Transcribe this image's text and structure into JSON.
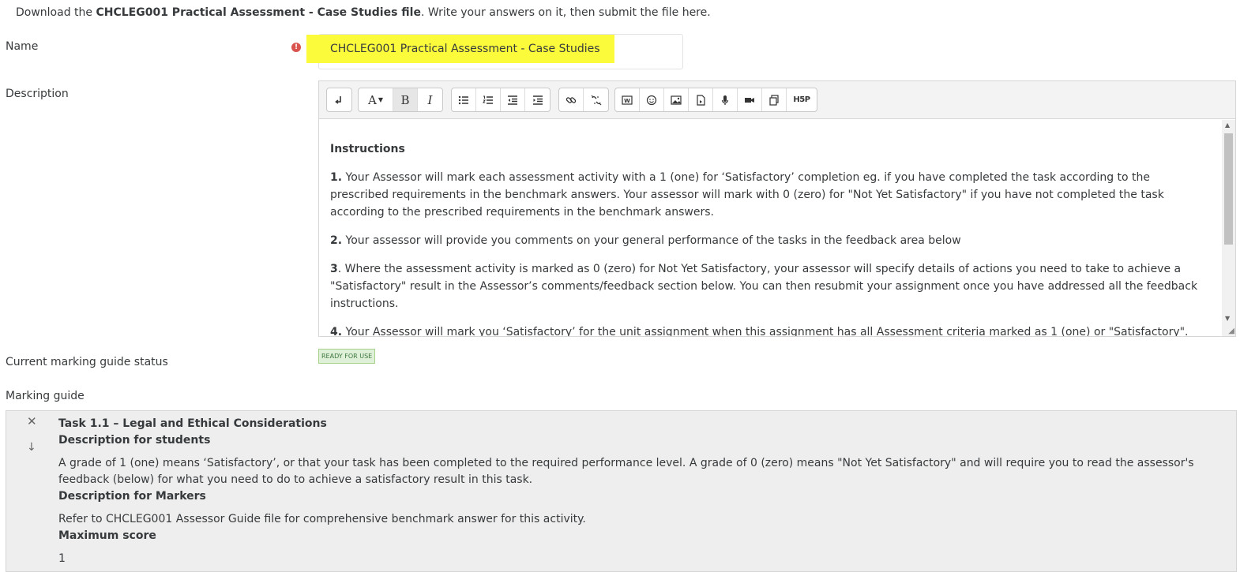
{
  "intro": {
    "prefix": "Download the ",
    "file_name": "CHCLEG001 Practical Assessment - Case Studies file",
    "suffix": ". Write your answers on it, then submit the file here."
  },
  "name_field": {
    "label": "Name",
    "value": "CHCLEG001 Practical Assessment - Case Studies",
    "required_icon": "exclamation-circle-icon"
  },
  "description": {
    "label": "Description",
    "toolbar": {
      "groups": [
        [
          "expand-toolbar-icon"
        ],
        [
          "font-style-icon",
          "bold-icon",
          "italic-icon"
        ],
        [
          "unordered-list-icon",
          "ordered-list-icon",
          "outdent-icon",
          "indent-icon"
        ],
        [
          "link-icon",
          "unlink-icon"
        ],
        [
          "word-import-icon",
          "emoticon-icon",
          "image-icon",
          "media-icon",
          "record-audio-icon",
          "record-video-icon",
          "manage-files-icon",
          "h5p-icon"
        ]
      ],
      "font_style_label": "A",
      "bold_label": "B",
      "italic_label": "I",
      "h5p_label": "H5P",
      "word_label": "W"
    },
    "content": {
      "heading": "Instructions",
      "items": [
        {
          "num": "1.",
          "text": "  Your Assessor will mark each assessment activity with a 1 (one) for  ‘Satisfactory’ completion eg. if you have completed the task according to the prescribed requirements in the benchmark answers. Your assessor will mark with 0 (zero) for \"Not Yet Satisfactory\" if you have not completed the task according to the prescribed requirements in the benchmark answers."
        },
        {
          "num": "2.",
          "text": "  Your assessor will provide you comments on your general performance of the tasks in the feedback area below"
        },
        {
          "num": "3",
          "text": ". Where the assessment activity is marked as 0 (zero) for Not Yet Satisfactory, your assessor will specify details of actions you need to take to achieve a \"Satisfactory\" result in the Assessor’s comments/feedback section below. You can then resubmit your assignment once you have addressed all the feedback instructions."
        },
        {
          "num": "4.",
          "text": " Your Assessor will mark you ‘Satisfactory’ for the unit assignment when this assignment has all Assessment criteria marked as 1 (one) or \"Satisfactory\"."
        }
      ]
    }
  },
  "marking_status": {
    "label": "Current marking guide status",
    "badge": "READY FOR USE",
    "badge_color": "#dff0d8"
  },
  "marking_guide": {
    "label": "Marking guide",
    "criterion": {
      "title": "Task 1.1 – Legal and Ethical Considerations",
      "students_heading": "Description for students",
      "students_text": "A grade of 1 (one) means ‘Satisfactory’, or that your task has been completed to the required performance level. A grade of 0 (zero) means \"Not Yet Satisfactory\" and will require you to read the assessor's feedback (below) for what you need to do to achieve a satisfactory result in this task.",
      "markers_heading": "Description for Markers",
      "markers_text": "Refer to CHCLEG001 Assessor Guide file for comprehensive benchmark answer for this activity.",
      "max_score_heading": "Maximum score",
      "max_score": "1"
    },
    "delete_icon": "close-icon",
    "move_down_icon": "arrow-down-icon"
  },
  "colors": {
    "highlight": "#fbfb3b",
    "required": "#d9534f",
    "text": "#373a3c",
    "guide_bg": "#eeeeee"
  }
}
